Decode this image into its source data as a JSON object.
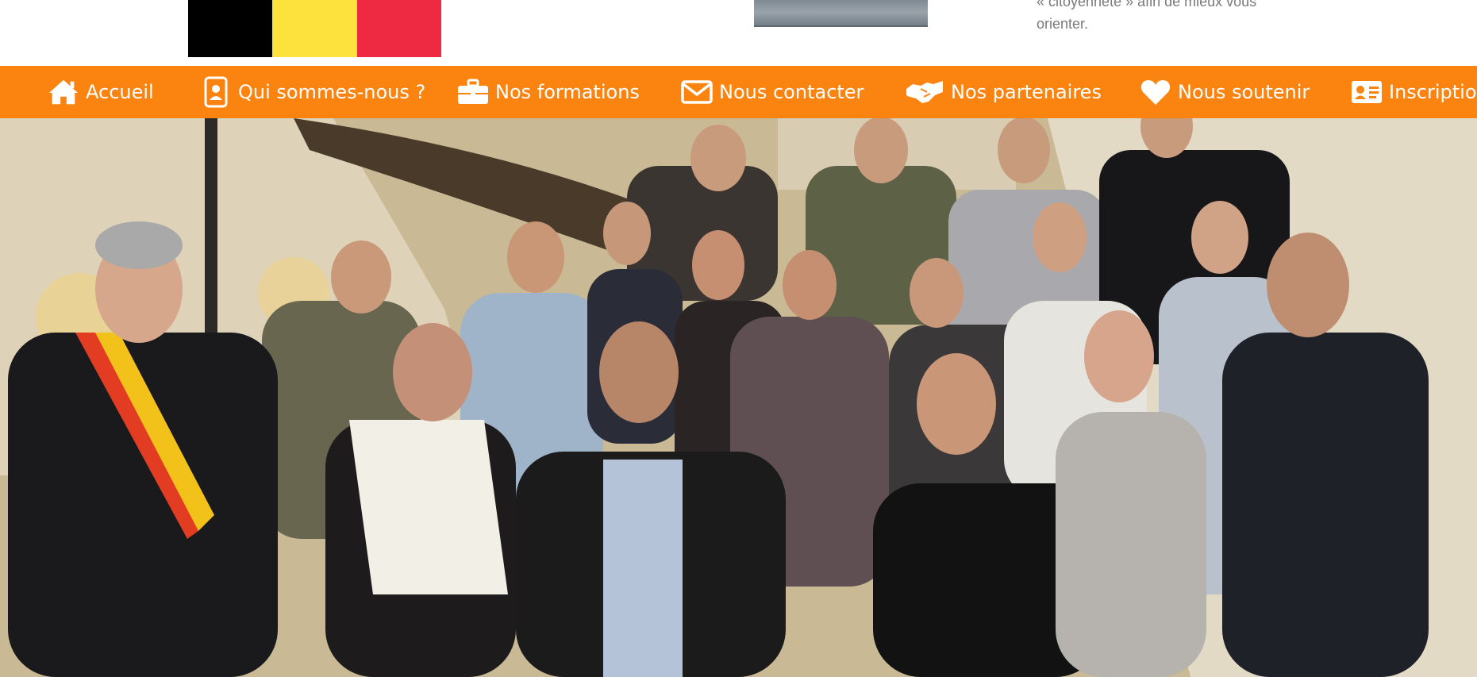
{
  "header": {
    "flag_colors": [
      "#000000",
      "#fde13d",
      "#ee2a42"
    ],
    "excerpt_line1": "« citoyenneté » afin de mieux vous",
    "excerpt_line2": "orienter."
  },
  "nav": {
    "background": "#fb8411",
    "items": [
      {
        "label": "Accueil",
        "icon": "home-icon"
      },
      {
        "label": "Qui sommes-nous ?",
        "icon": "id-badge-icon"
      },
      {
        "label": "Nos formations",
        "icon": "briefcase-icon"
      },
      {
        "label": "Nous contacter",
        "icon": "envelope-icon"
      },
      {
        "label": "Nos partenaires",
        "icon": "handshake-icon"
      },
      {
        "label": "Nous soutenir",
        "icon": "heart-icon"
      },
      {
        "label": "Inscription",
        "icon": "id-card-icon"
      }
    ]
  }
}
